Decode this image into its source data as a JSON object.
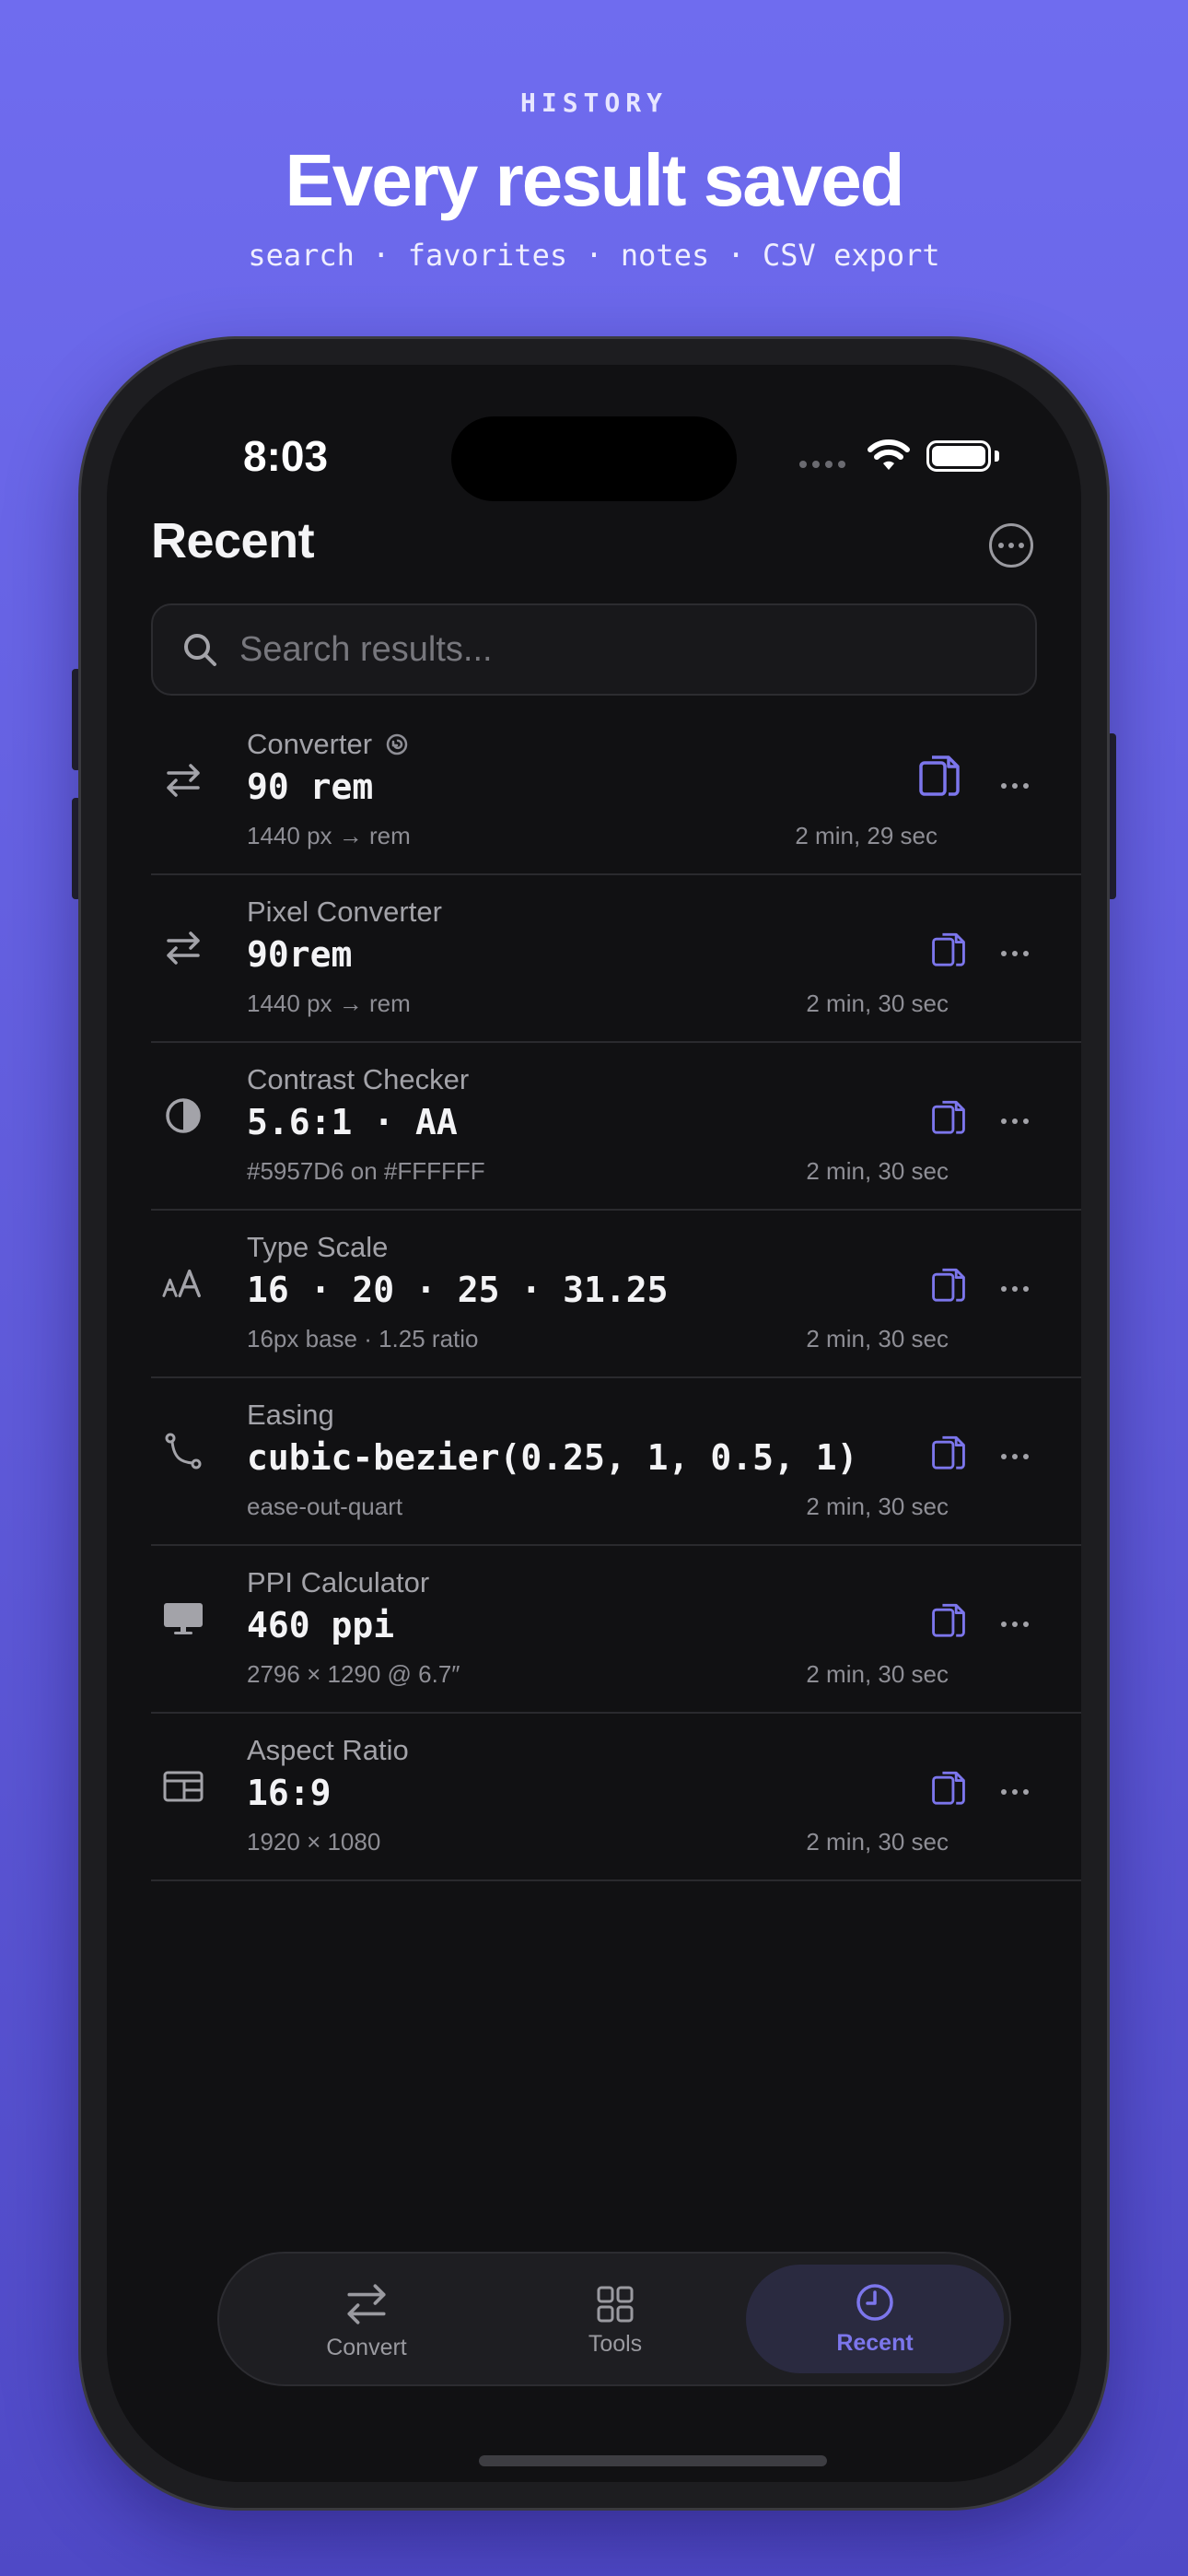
{
  "hero": {
    "eyebrow": "HISTORY",
    "title": "Every result saved",
    "subtitle": "search · favorites · notes · CSV export"
  },
  "status_bar": {
    "time": "8:03"
  },
  "header": {
    "title": "Recent"
  },
  "search": {
    "placeholder": "Search results..."
  },
  "results": [
    {
      "category": "Converter",
      "value": "90 rem",
      "detail": "1440 px → rem",
      "time": "2 min, 29 sec",
      "icon": "arrows-swap-icon",
      "has_restore": true
    },
    {
      "category": "Pixel Converter",
      "value": "90rem",
      "detail": "1440 px → rem",
      "time": "2 min, 30 sec",
      "icon": "arrows-swap-icon"
    },
    {
      "category": "Contrast Checker",
      "value": "5.6:1 · AA",
      "detail": "#5957D6 on #FFFFFF",
      "time": "2 min, 30 sec",
      "icon": "contrast-icon"
    },
    {
      "category": "Type Scale",
      "value": "16 · 20 · 25 · 31.25",
      "detail": "16px base · 1.25 ratio",
      "time": "2 min, 30 sec",
      "icon": "type-size-icon"
    },
    {
      "category": "Easing",
      "value": "cubic-bezier(0.25, 1, 0.5, 1)",
      "detail": "ease-out-quart",
      "time": "2 min, 30 sec",
      "icon": "bezier-curve-icon"
    },
    {
      "category": "PPI Calculator",
      "value": "460 ppi",
      "detail": "2796 × 1290 @ 6.7″",
      "time": "2 min, 30 sec",
      "icon": "monitor-icon"
    },
    {
      "category": "Aspect Ratio",
      "value": "16:9",
      "detail": "1920 × 1080",
      "time": "2 min, 30 sec",
      "icon": "aspect-ratio-icon"
    }
  ],
  "tabs": [
    {
      "label": "Convert",
      "icon": "arrows-swap-icon"
    },
    {
      "label": "Tools",
      "icon": "grid-icon"
    },
    {
      "label": "Recent",
      "icon": "clock-icon",
      "active": true
    }
  ],
  "colors": {
    "accent": "#7c76ec",
    "background": "#111113",
    "backdrop": "#6f6cef"
  }
}
